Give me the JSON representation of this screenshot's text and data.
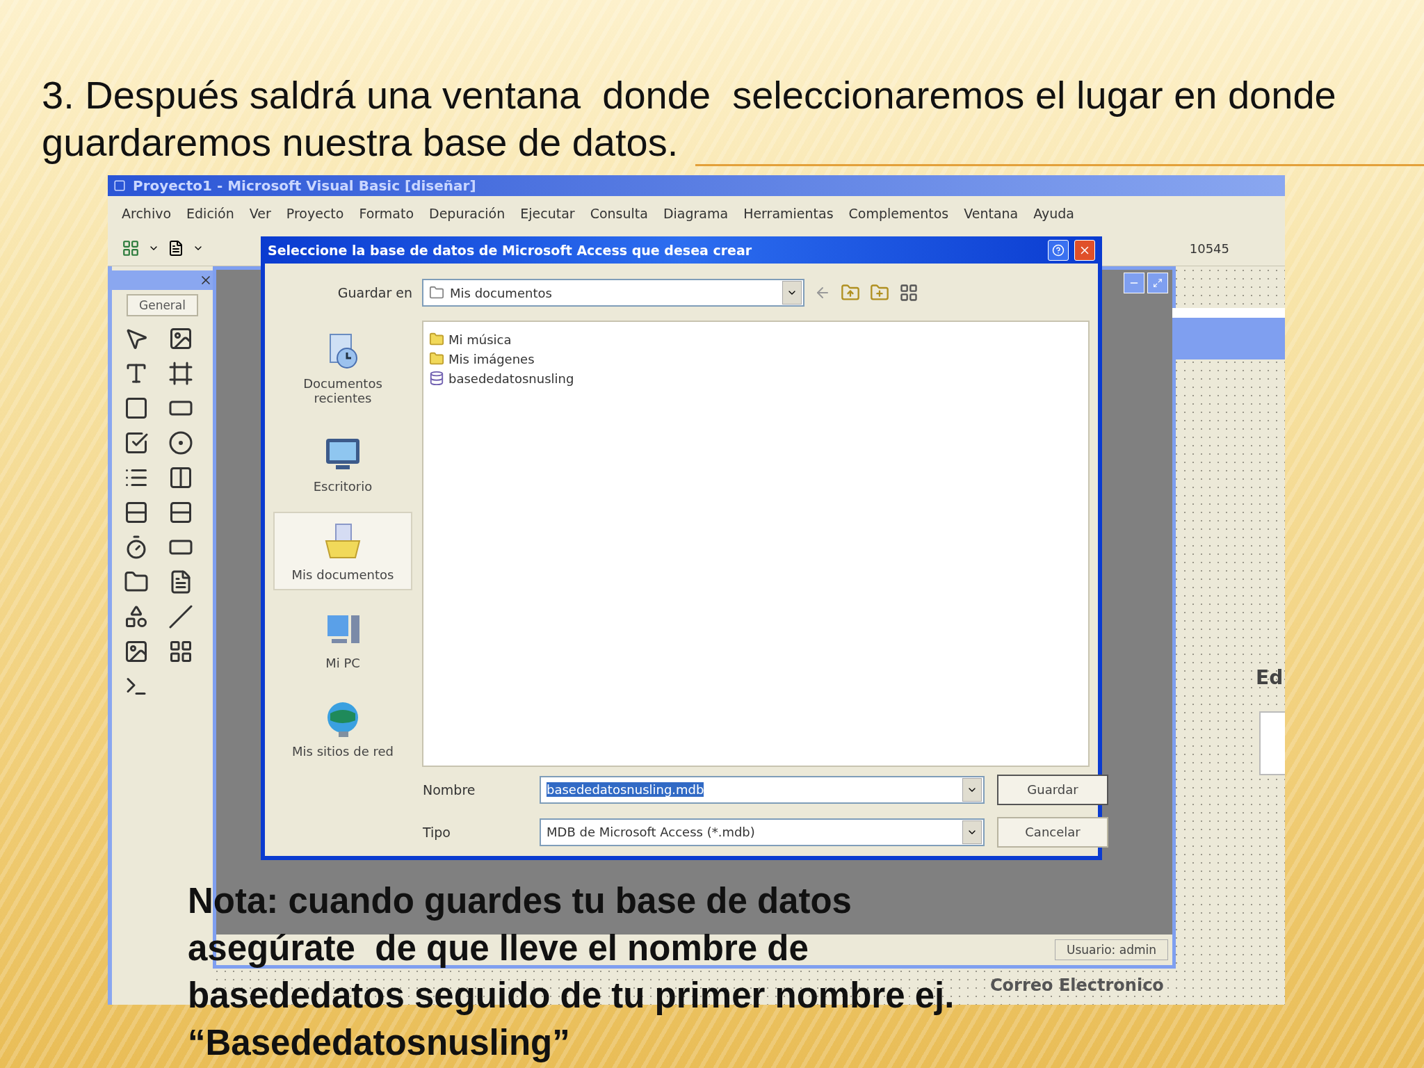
{
  "slide": {
    "title": "3. Después saldrá una ventana  donde  seleccionaremos el lugar en donde guardaremos nuestra base de datos.",
    "note": "Nota: cuando guardes tu base de datos asegúrate  de que lleve el nombre de basededatos seguido de tu primer nombre ej. “Basededatosnusling”"
  },
  "vb_window": {
    "title": "Proyecto1 - Microsoft Visual Basic [diseñar]",
    "menu": [
      "Archivo",
      "Edición",
      "Ver",
      "Proyecto",
      "Formato",
      "Depuración",
      "Ejecutar",
      "Consulta",
      "Diagrama",
      "Herramientas",
      "Complementos",
      "Ventana",
      "Ayuda"
    ],
    "toolbar_text": "10545",
    "toolbox_tab": "General"
  },
  "designer": {
    "status": "Usuario: admin",
    "form_label": "Ed",
    "field_label": "Correo Electronico"
  },
  "dialog": {
    "title": "Seleccione la base de datos de Microsoft Access que desea crear",
    "save_in_label": "Guardar en",
    "save_in_value": "Mis documentos",
    "places": [
      {
        "label": "Documentos recientes",
        "selected": false
      },
      {
        "label": "Escritorio",
        "selected": false
      },
      {
        "label": "Mis documentos",
        "selected": true
      },
      {
        "label": "Mi PC",
        "selected": false
      },
      {
        "label": "Mis sitios de red",
        "selected": false
      }
    ],
    "files": [
      {
        "name": "Mi música",
        "kind": "folder"
      },
      {
        "name": "Mis imágenes",
        "kind": "folder"
      },
      {
        "name": "basededatosnusling",
        "kind": "database"
      }
    ],
    "name_label": "Nombre",
    "name_value": "basededatosnusling.mdb",
    "name_value_selected": true,
    "type_label": "Tipo",
    "type_value": "MDB de Microsoft Access (*.mdb)",
    "buttons": [
      "Guardar",
      "Cancelar"
    ]
  }
}
